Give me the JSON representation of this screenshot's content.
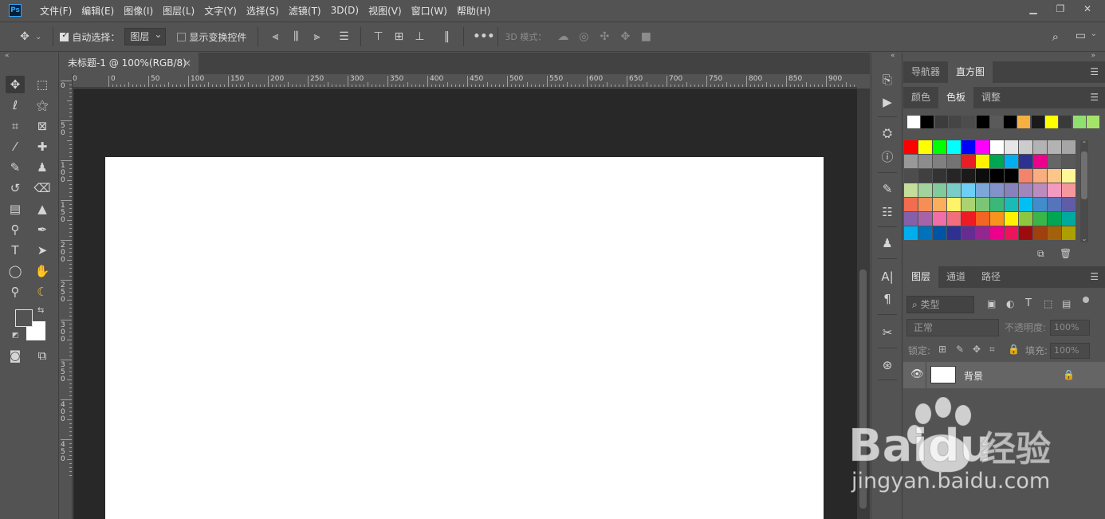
{
  "app": {
    "logo": "Ps",
    "title": "Adobe Photoshop"
  },
  "menu": [
    "文件(F)",
    "编辑(E)",
    "图像(I)",
    "图层(L)",
    "文字(Y)",
    "选择(S)",
    "滤镜(T)",
    "3D(D)",
    "视图(V)",
    "窗口(W)",
    "帮助(H)"
  ],
  "window_controls": [
    "minimize-icon",
    "restore-icon",
    "close-icon"
  ],
  "options": {
    "auto_select_label": "自动选择：",
    "auto_select_checked": true,
    "layer_select_value": "图层",
    "show_transform_label": "显示变换控件",
    "show_transform_checked": false,
    "mode_3d_label": "3D 模式："
  },
  "document": {
    "tab_title": "未标题-1 @ 100%(RGB/8)",
    "close": "×"
  },
  "ruler": {
    "top_labels": [
      "0",
      "50",
      "100",
      "150",
      "200",
      "250",
      "300",
      "350",
      "400",
      "450",
      "500",
      "550",
      "600",
      "650",
      "700",
      "750",
      "800",
      "850",
      "900"
    ],
    "top_first": "0",
    "left_labels": [
      "0",
      "50",
      "100",
      "150",
      "200",
      "250",
      "300",
      "350",
      "400",
      "450"
    ]
  },
  "panels": {
    "top_tabs": [
      "导航器",
      "直方图"
    ],
    "top_active": 1,
    "color_tabs": [
      "颜色",
      "色板",
      "调整"
    ],
    "color_active": 1,
    "layer_tabs": [
      "图层",
      "通道",
      "路径"
    ],
    "layer_active": 0
  },
  "swatches": {
    "recent": [
      "#ffffff",
      "#000000",
      "#3c3c3c",
      "#454545",
      "#4c4c4c",
      "#000000",
      "#5a5a5a",
      "#000000",
      "#f5b041",
      "#1a1a1a",
      "#ffff00",
      "#3a3a3a",
      "#8fe070",
      "#a6e36a"
    ],
    "grid": [
      [
        "#ff0000",
        "#ffff00",
        "#00ff00",
        "#00ffff",
        "#0000ff",
        "#ff00ff",
        "#ffffff",
        "#e6e6e6",
        "#cccccc",
        "#b3b3b3",
        "#b3b3b3",
        "#a6a6a6"
      ],
      [
        "#999999",
        "#8c8c8c",
        "#808080",
        "#737373",
        "#e81e26",
        "#fff200",
        "#00a651",
        "#00aeef",
        "#2e3192",
        "#ec008c",
        "#666666",
        "#595959"
      ],
      [
        "#4d4d4d",
        "#404040",
        "#333333",
        "#262626",
        "#1a1a1a",
        "#0d0d0d",
        "#000000",
        "#000000",
        "#f3836b",
        "#f9ad81",
        "#fdc689",
        "#fff799"
      ],
      [
        "#c4df9b",
        "#a3d39c",
        "#82ca9c",
        "#7accc8",
        "#6dcff6",
        "#7da7d9",
        "#8393ca",
        "#8781bd",
        "#a186be",
        "#bd8cbf",
        "#f49ac1",
        "#f5989d"
      ],
      [
        "#f26c4f",
        "#f68e55",
        "#fbaf5c",
        "#fff467",
        "#acd372",
        "#7cc576",
        "#3bb878",
        "#1abbb4",
        "#00bff3",
        "#438ccb",
        "#5574b9",
        "#605ca8"
      ],
      [
        "#855fa8",
        "#a763a8",
        "#f06ea9",
        "#f26d7d",
        "#ed1c24",
        "#f26522",
        "#f7941d",
        "#fff200",
        "#8dc73f",
        "#39b54a",
        "#00a651",
        "#00a99d"
      ],
      [
        "#00aeef",
        "#0072bc",
        "#0054a6",
        "#2e3192",
        "#662d91",
        "#92278f",
        "#ec008c",
        "#ed145b",
        "#9e0b0f",
        "#a0410d",
        "#a3620a",
        "#aba000"
      ]
    ]
  },
  "layers": {
    "search_placeholder": "类型",
    "blend_mode": "正常",
    "opacity_label": "不透明度:",
    "opacity_value": "100%",
    "lock_label": "锁定:",
    "fill_label": "填充:",
    "fill_value": "100%",
    "items": [
      {
        "name": "背景",
        "visible": true,
        "locked": true
      }
    ]
  },
  "watermark": {
    "brand": "Baidu",
    "cn": "经验",
    "url": "jingyan.baidu.com"
  }
}
